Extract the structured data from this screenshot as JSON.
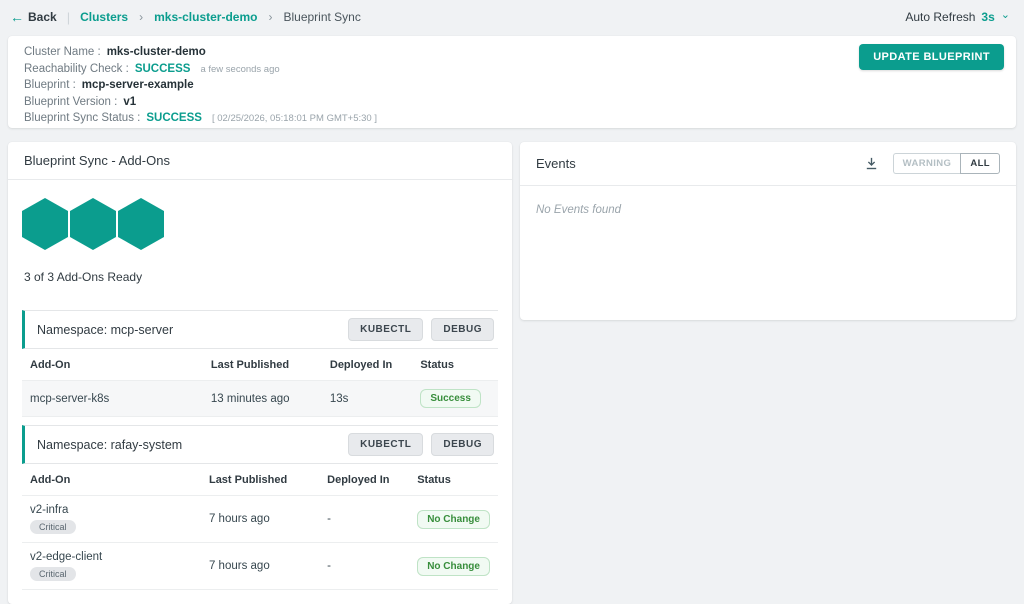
{
  "colors": {
    "accent_teal": "#0b9d8e",
    "status_green": "#388e3c",
    "status_green_bg": "#f1faf3",
    "page_background": "#f0f2f4"
  },
  "topbar": {
    "back_label": "Back",
    "breadcrumb_root": "Clusters",
    "breadcrumb_cluster": "mks-cluster-demo",
    "breadcrumb_current": "Blueprint Sync",
    "separator": "›",
    "auto_refresh_label": "Auto Refresh",
    "auto_refresh_value": "3s"
  },
  "cluster_info": {
    "cluster_name_label": "Cluster Name :",
    "cluster_name": "mks-cluster-demo",
    "reachability_label": "Reachability Check :",
    "reachability_status": "SUCCESS",
    "reachability_time": "a few seconds ago",
    "blueprint_label": "Blueprint :",
    "blueprint": "mcp-server-example",
    "version_label": "Blueprint Version :",
    "version": "v1",
    "sync_status_label": "Blueprint Sync Status :",
    "sync_status": "SUCCESS",
    "sync_timestamp": "[ 02/25/2026, 05:18:01 PM GMT+5:30 ]",
    "update_button_label": "UPDATE BLUEPRINT"
  },
  "addons_panel": {
    "title": "Blueprint Sync - Add-Ons",
    "hexagon_count": 3,
    "ready_text": "3 of 3 Add-Ons Ready",
    "namespaces": [
      {
        "title": "Namespace: mcp-server",
        "kubectl_label": "KUBECTL",
        "debug_label": "DEBUG",
        "columns": [
          "Add-On",
          "Last Published",
          "Deployed In",
          "Status"
        ],
        "rows": [
          {
            "addon": "mcp-server-k8s",
            "tag": "",
            "last_published": "13 minutes ago",
            "deployed_in": "13s",
            "status": "Success"
          }
        ]
      },
      {
        "title": "Namespace: rafay-system",
        "kubectl_label": "KUBECTL",
        "debug_label": "DEBUG",
        "columns": [
          "Add-On",
          "Last Published",
          "Deployed In",
          "Status"
        ],
        "rows": [
          {
            "addon": "v2-infra",
            "tag": "Critical",
            "last_published": "7 hours ago",
            "deployed_in": "-",
            "status": "No Change"
          },
          {
            "addon": "v2-edge-client",
            "tag": "Critical",
            "last_published": "7 hours ago",
            "deployed_in": "-",
            "status": "No Change"
          }
        ]
      }
    ]
  },
  "events_panel": {
    "title": "Events",
    "filter_warning_label": "WARNING",
    "filter_all_label": "ALL",
    "empty_text": "No Events found"
  }
}
